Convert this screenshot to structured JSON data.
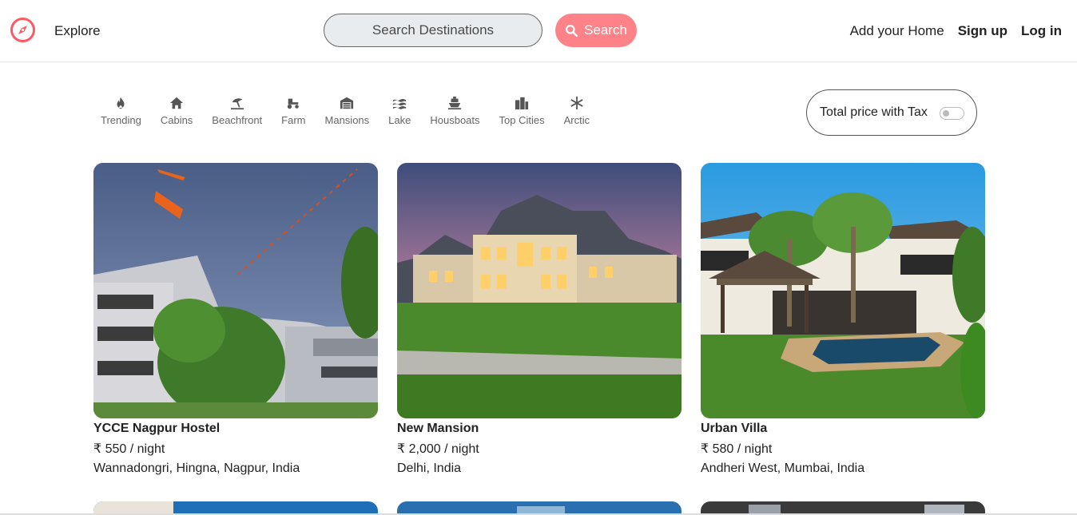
{
  "nav": {
    "explore_label": "Explore",
    "search_placeholder": "Search Destinations",
    "search_button": "Search",
    "add_home": "Add your Home",
    "signup": "Sign up",
    "login": "Log in",
    "brand_color": "#fe5a64",
    "accent_color": "#fe8288"
  },
  "filters": [
    {
      "label": "Trending",
      "icon": "fire-icon"
    },
    {
      "label": "Cabins",
      "icon": "home-icon"
    },
    {
      "label": "Beachfront",
      "icon": "umbrella-beach-icon"
    },
    {
      "label": "Farm",
      "icon": "tractor-icon"
    },
    {
      "label": "Mansions",
      "icon": "warehouse-icon"
    },
    {
      "label": "Lake",
      "icon": "water-icon"
    },
    {
      "label": "Housboats",
      "icon": "ship-icon"
    },
    {
      "label": "Top Cities",
      "icon": "city-icon"
    },
    {
      "label": "Arctic",
      "icon": "snowflake-icon"
    }
  ],
  "tax_toggle": {
    "label": "Total price with Tax",
    "enabled": false
  },
  "listings": [
    {
      "title": "YCCE Nagpur Hostel",
      "price": "₹ 550 / night",
      "location": "Wannadongri, Hingna, Nagpur, India"
    },
    {
      "title": "New Mansion",
      "price": "₹ 2,000 / night",
      "location": "Delhi, India"
    },
    {
      "title": "Urban Villa",
      "price": "₹ 580 / night",
      "location": "Andheri West, Mumbai, India"
    }
  ]
}
